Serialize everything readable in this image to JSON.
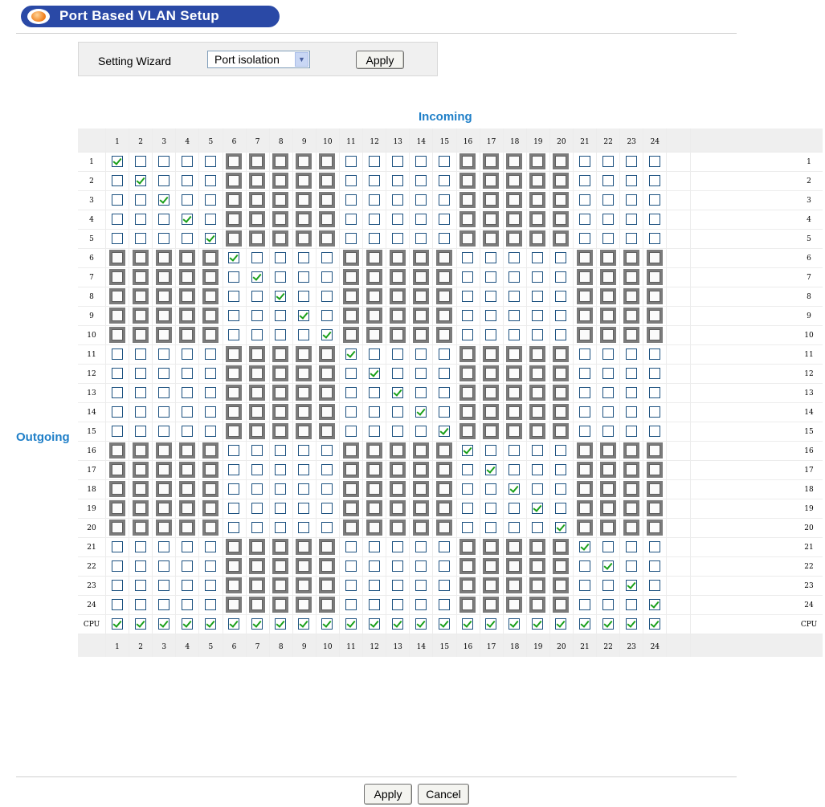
{
  "page": {
    "title": "Port Based VLAN Setup",
    "setting_wizard_label": "Setting Wizard",
    "wizard_select_value": "Port isolation",
    "apply_label": "Apply",
    "cancel_label": "Cancel"
  },
  "matrix": {
    "incoming_label": "Incoming",
    "outgoing_label": "Outgoing",
    "columns": [
      "1",
      "2",
      "3",
      "4",
      "5",
      "6",
      "7",
      "8",
      "9",
      "10",
      "11",
      "12",
      "13",
      "14",
      "15",
      "16",
      "17",
      "18",
      "19",
      "20",
      "21",
      "22",
      "23",
      "24"
    ],
    "rows": [
      "1",
      "2",
      "3",
      "4",
      "5",
      "6",
      "7",
      "8",
      "9",
      "10",
      "11",
      "12",
      "13",
      "14",
      "15",
      "16",
      "17",
      "18",
      "19",
      "20",
      "21",
      "22",
      "23",
      "24",
      "CPU"
    ],
    "checked_rule": "diagonal (outgoing port = incoming port) and all CPU row",
    "shaded_rule": "port group blocks of 5 (1-5, 6-10, 11-15, 16-20, 21-24); shaded where row group and column group parity differ",
    "colors": {
      "shade": "#7b7b7b",
      "check": "#1aa01a",
      "accent_label": "#1f7fc8",
      "title_bar": "#2a49a6"
    }
  }
}
